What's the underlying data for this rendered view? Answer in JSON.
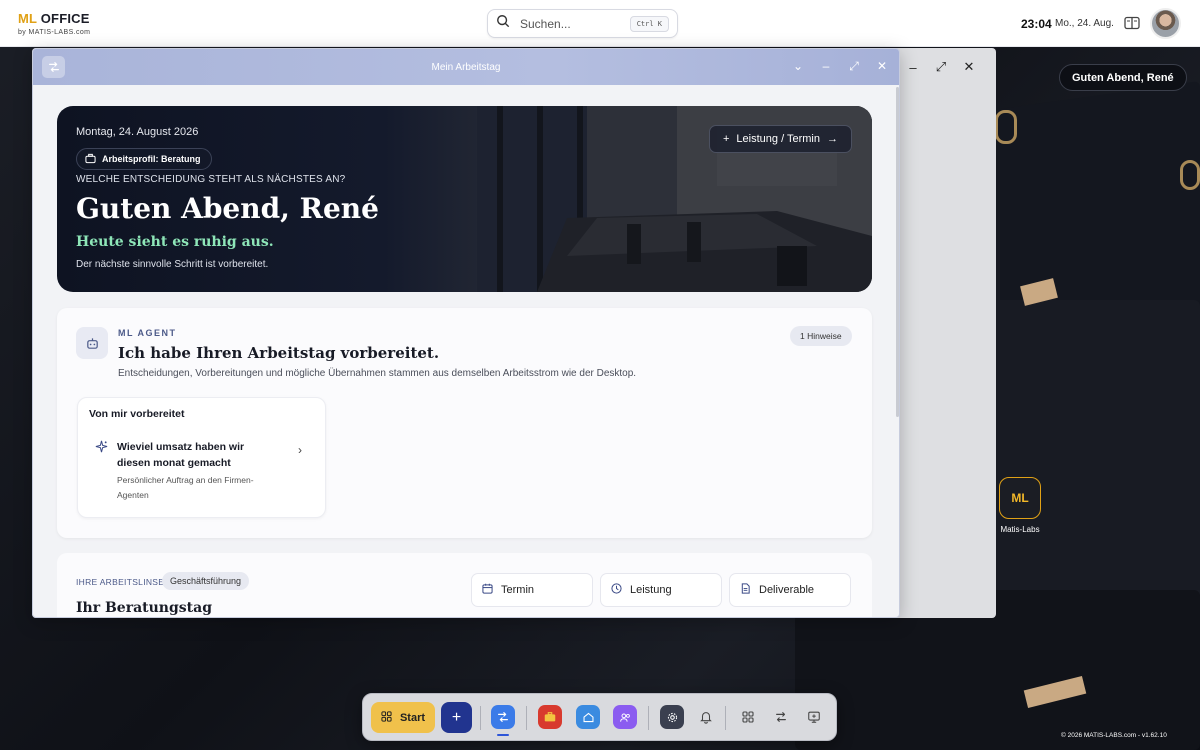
{
  "topbar": {
    "brand_ml": "ML",
    "brand_office": " OFFICE",
    "brand_sub": "by MATIS-LABS.com",
    "search_placeholder": "Suchen...",
    "search_shortcut": "Ctrl K",
    "time": "23:04",
    "date": "Mo., 24. Aug."
  },
  "desktop": {
    "greeting": "Guten Abend, René",
    "app_icon_text": "ML",
    "app_label": "Matis-Labs",
    "copyright": "© 2026 MATIS-LABS.com - v1.62.10"
  },
  "window": {
    "title": "Mein Arbeitstag"
  },
  "hero": {
    "date": "Montag, 24. August 2026",
    "profile_chip": "Arbeitsprofil: Beratung",
    "question": "WELCHE ENTSCHEIDUNG STEHT ALS NÄCHSTES AN?",
    "title": "Guten Abend, René",
    "subtitle": "Heute sieht es ruhig aus.",
    "description": "Der nächste sinnvolle Schritt ist vorbereitet.",
    "action_button": "Leistung / Termin"
  },
  "agent": {
    "eyebrow": "ML AGENT",
    "title": "Ich habe Ihren Arbeitstag vorbereitet.",
    "description": "Entscheidungen, Vorbereitungen und mögliche Übernahmen stammen aus demselben Arbeitsstrom wie der Desktop.",
    "hint_badge": "1 Hinweise",
    "prepared_title": "Von mir vorbereitet",
    "prepared_item_title": "Wieviel umsatz haben wir diesen monat gemacht",
    "prepared_item_sub": "Persönlicher Auftrag an den Firmen-Agenten"
  },
  "work": {
    "eyebrow": "IHRE ARBEITSLINSE",
    "chip": "Geschäftsführung",
    "title": "Ihr Beratungstag",
    "actions": [
      "Termin",
      "Leistung",
      "Deliverable"
    ]
  },
  "dock": {
    "start_label": "Start"
  },
  "colors": {
    "accent_gold": "#f0c14b",
    "brand_blue": "#21348f",
    "mint": "#8ee6b8",
    "titlebar": "#a9b4d9"
  }
}
